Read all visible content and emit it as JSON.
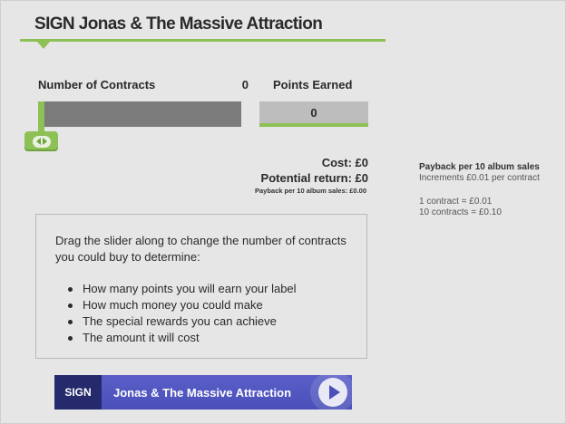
{
  "header": {
    "title": "SIGN Jonas & The Massive Attraction"
  },
  "contracts": {
    "label": "Number of Contracts",
    "value": "0",
    "slider_fraction": 0
  },
  "points": {
    "label": "Points Earned",
    "value": "0"
  },
  "summary": {
    "cost": "Cost: £0",
    "potential_return": "Potential return: £0",
    "payback_note": "Payback per 10 album sales: £0.00"
  },
  "side_info": {
    "heading": "Payback per 10 album sales",
    "increments": "Increments £0.01 per contract",
    "one_contract": "1 contract = £0.01",
    "ten_contracts": "10 contracts = £0.10"
  },
  "instructions": {
    "intro": "Drag the slider along to change the number of contracts you could buy to determine:",
    "bullets": [
      "How many points you will earn your label",
      "How much money you could make",
      "The special rewards you can achieve",
      "The amount it will cost"
    ]
  },
  "sign_button": {
    "prefix": "SIGN",
    "label": "Jonas & The Massive Attraction",
    "icon": "play-icon"
  },
  "colors": {
    "accent_green": "#8dc055",
    "track_gray": "#7b7b7b",
    "button_navy": "#242a6b",
    "button_blue": "#4a4fb9"
  }
}
